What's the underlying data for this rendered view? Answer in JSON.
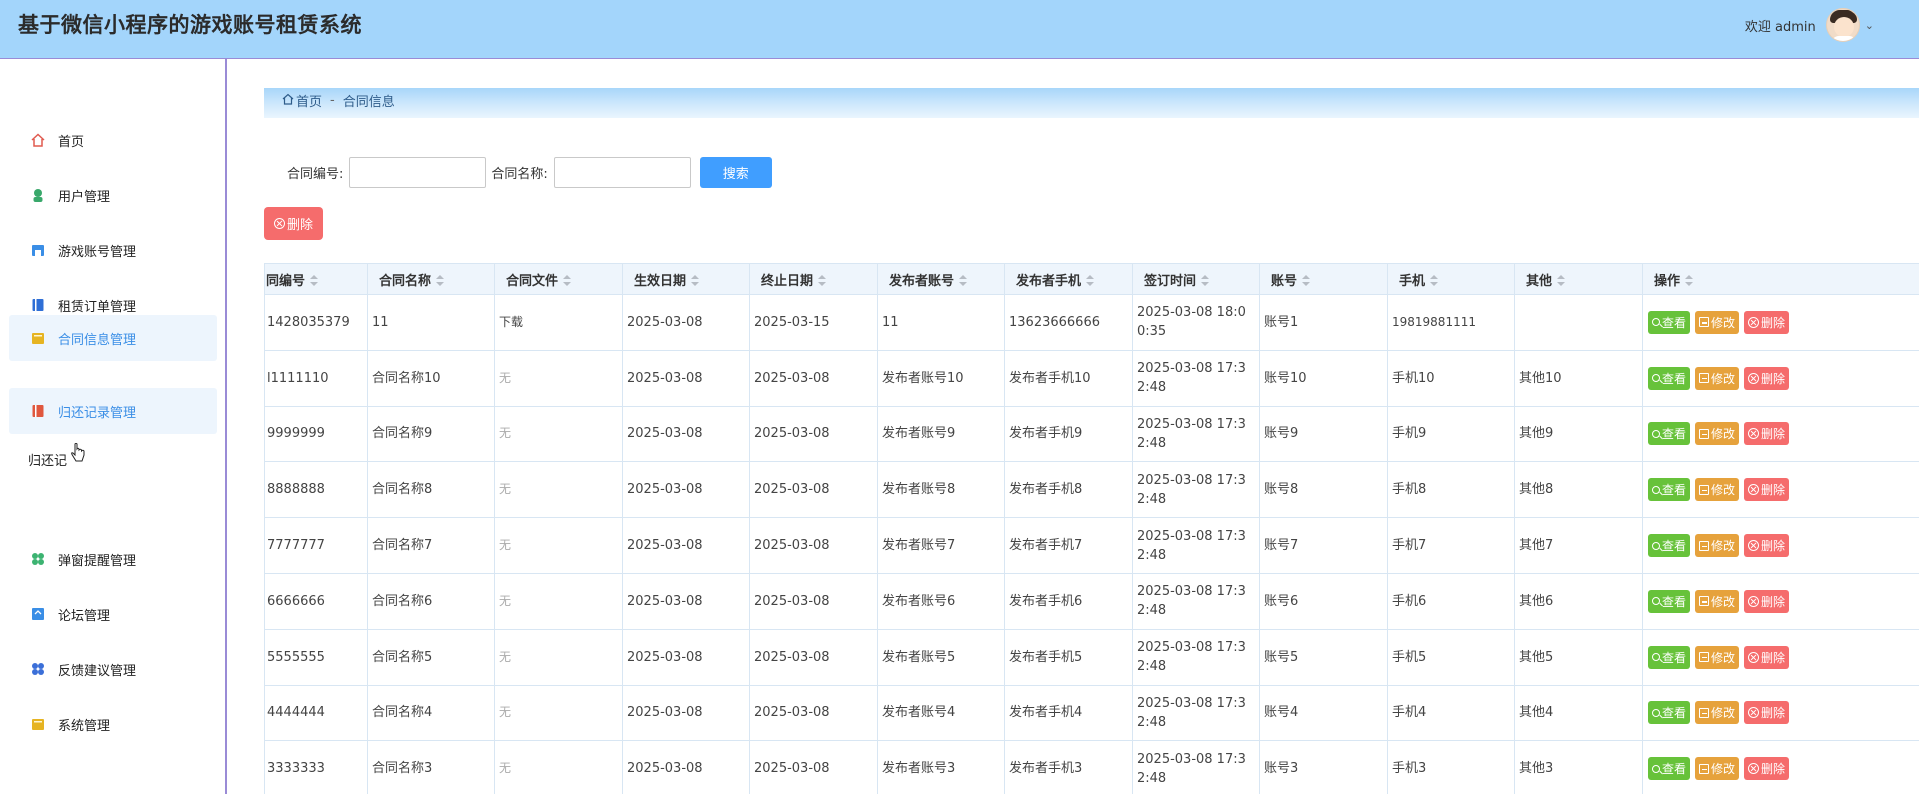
{
  "header": {
    "app_title": "基于微信小程序的游戏账号租赁系统",
    "welcome": "欢迎 admin"
  },
  "sidebar": {
    "items": [
      {
        "label": "首页",
        "icon": "home-icon",
        "color": "#e05a4f"
      },
      {
        "label": "用户管理",
        "icon": "user-icon",
        "color": "#39a86b"
      },
      {
        "label": "游戏账号管理",
        "icon": "store-icon",
        "color": "#3a8ee6"
      },
      {
        "label": "租赁订单管理",
        "icon": "book-icon",
        "color": "#2f6fd6"
      },
      {
        "label": "合同信息管理",
        "icon": "folder-icon",
        "color": "#e6b422"
      },
      {
        "label": "归还记录管理",
        "icon": "return-icon",
        "color": "#e0573e"
      },
      {
        "label": "弹窗提醒管理",
        "icon": "clover-icon",
        "color": "#3cb371"
      },
      {
        "label": "论坛管理",
        "icon": "forum-icon",
        "color": "#3a8ee6"
      },
      {
        "label": "反馈建议管理",
        "icon": "grid-icon",
        "color": "#3b6fd8"
      },
      {
        "label": "系统管理",
        "icon": "settings-folder-icon",
        "color": "#e6b422"
      }
    ],
    "hover_tooltip": "归还记"
  },
  "breadcrumb": {
    "home": "首页",
    "separator": "-",
    "current": "合同信息"
  },
  "search": {
    "contract_no_label": "合同编号:",
    "contract_name_label": "合同名称:",
    "contract_no_value": "",
    "contract_name_value": "",
    "button": "搜索"
  },
  "toolbar": {
    "delete_label": "删除"
  },
  "table": {
    "columns": [
      "同编号",
      "合同名称",
      "合同文件",
      "生效日期",
      "终止日期",
      "发布者账号",
      "发布者手机",
      "签订时间",
      "账号",
      "手机",
      "其他",
      "操作"
    ],
    "actions": {
      "view": "查看",
      "edit": "修改",
      "delete": "删除"
    },
    "rows": [
      [
        "1428035379",
        "11",
        "下载",
        "2025-03-08",
        "2025-03-15",
        "11",
        "13623666666",
        "2025-03-08 18:00:35",
        "账号1",
        "19819881111",
        ""
      ],
      [
        "l1111110",
        "合同名称10",
        "无",
        "2025-03-08",
        "2025-03-08",
        "发布者账号10",
        "发布者手机10",
        "2025-03-08 17:32:48",
        "账号10",
        "手机10",
        "其他10"
      ],
      [
        "9999999",
        "合同名称9",
        "无",
        "2025-03-08",
        "2025-03-08",
        "发布者账号9",
        "发布者手机9",
        "2025-03-08 17:32:48",
        "账号9",
        "手机9",
        "其他9"
      ],
      [
        "8888888",
        "合同名称8",
        "无",
        "2025-03-08",
        "2025-03-08",
        "发布者账号8",
        "发布者手机8",
        "2025-03-08 17:32:48",
        "账号8",
        "手机8",
        "其他8"
      ],
      [
        "7777777",
        "合同名称7",
        "无",
        "2025-03-08",
        "2025-03-08",
        "发布者账号7",
        "发布者手机7",
        "2025-03-08 17:32:48",
        "账号7",
        "手机7",
        "其他7"
      ],
      [
        "6666666",
        "合同名称6",
        "无",
        "2025-03-08",
        "2025-03-08",
        "发布者账号6",
        "发布者手机6",
        "2025-03-08 17:32:48",
        "账号6",
        "手机6",
        "其他6"
      ],
      [
        "5555555",
        "合同名称5",
        "无",
        "2025-03-08",
        "2025-03-08",
        "发布者账号5",
        "发布者手机5",
        "2025-03-08 17:32:48",
        "账号5",
        "手机5",
        "其他5"
      ],
      [
        "4444444",
        "合同名称4",
        "无",
        "2025-03-08",
        "2025-03-08",
        "发布者账号4",
        "发布者手机4",
        "2025-03-08 17:32:48",
        "账号4",
        "手机4",
        "其他4"
      ],
      [
        "3333333",
        "合同名称3",
        "无",
        "2025-03-08",
        "2025-03-08",
        "发布者账号3",
        "发布者手机3",
        "2025-03-08 17:32:48",
        "账号3",
        "手机3",
        "其他3"
      ]
    ]
  },
  "colors": {
    "header_bg": "#a3d5fb",
    "primary": "#409eff",
    "danger": "#f56c6c",
    "success": "#67c23a",
    "warning": "#e6a23c",
    "active_nav": "#3a8ee6"
  }
}
